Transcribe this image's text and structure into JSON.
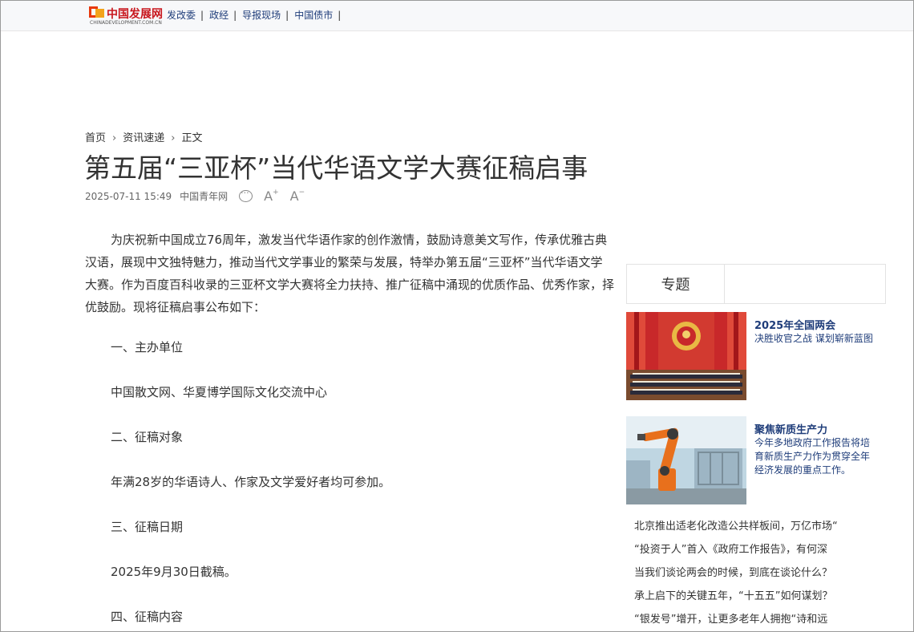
{
  "header": {
    "logo_text": "中国发展网",
    "logo_sub": "CHINADEVELOPMENT.COM.CN",
    "nav": [
      "发改委",
      "政经",
      "导报现场",
      "中国债市"
    ]
  },
  "breadcrumb": [
    "首页",
    "资讯速递",
    "正文"
  ],
  "article": {
    "title": "第五届“三亚杯”当代华语文学大赛征稿启事",
    "date": "2025-07-11 15:49",
    "source": "中国青年网",
    "font_increase": "A",
    "font_decrease": "A",
    "lead": "为庆祝新中国成立76周年，激发当代华语作家的创作激情，鼓励诗意美文写作，传承优雅古典汉语，展现中文独特魅力，推动当代文学事业的繁荣与发展，特举办第五届“三亚杯”当代华语文学大赛。作为百度百科收录的三亚杯文学大赛将全力扶持、推广征稿中涌现的优质作品、优秀作家，择优鼓励。现将征稿启事公布如下：",
    "sections": [
      "一、主办单位",
      "中国散文网、华夏博学国际文化交流中心",
      "二、征稿对象",
      "年满28岁的华语诗人、作家及文学爱好者均可参加。",
      "三、征稿日期",
      "2025年9月30日截稿。",
      "四、征稿内容"
    ]
  },
  "sidebar": {
    "tab_label": "专题",
    "cards": [
      {
        "title": "2025年全国两会",
        "desc": "决胜收官之战 谋划崭新蓝图"
      },
      {
        "title": "聚焦新质生产力",
        "desc": "今年多地政府工作报告将培育新质生产力作为贯穿全年经济发展的重点工作。"
      }
    ],
    "links": [
      "北京推出适老化改造公共样板间，万亿市场“",
      "“投资于人”首入《政府工作报告》，有何深",
      "当我们谈论两会的时候，到底在谈论什么？",
      "承上启下的关键五年，“十五五”如何谋划？",
      "“银发号”增开，让更多老年人拥抱“诗和远"
    ]
  },
  "colors": {
    "nav_blue": "#1f3d7a",
    "logo_red": "#c8161d",
    "logo_orange": "#f3a31b"
  }
}
